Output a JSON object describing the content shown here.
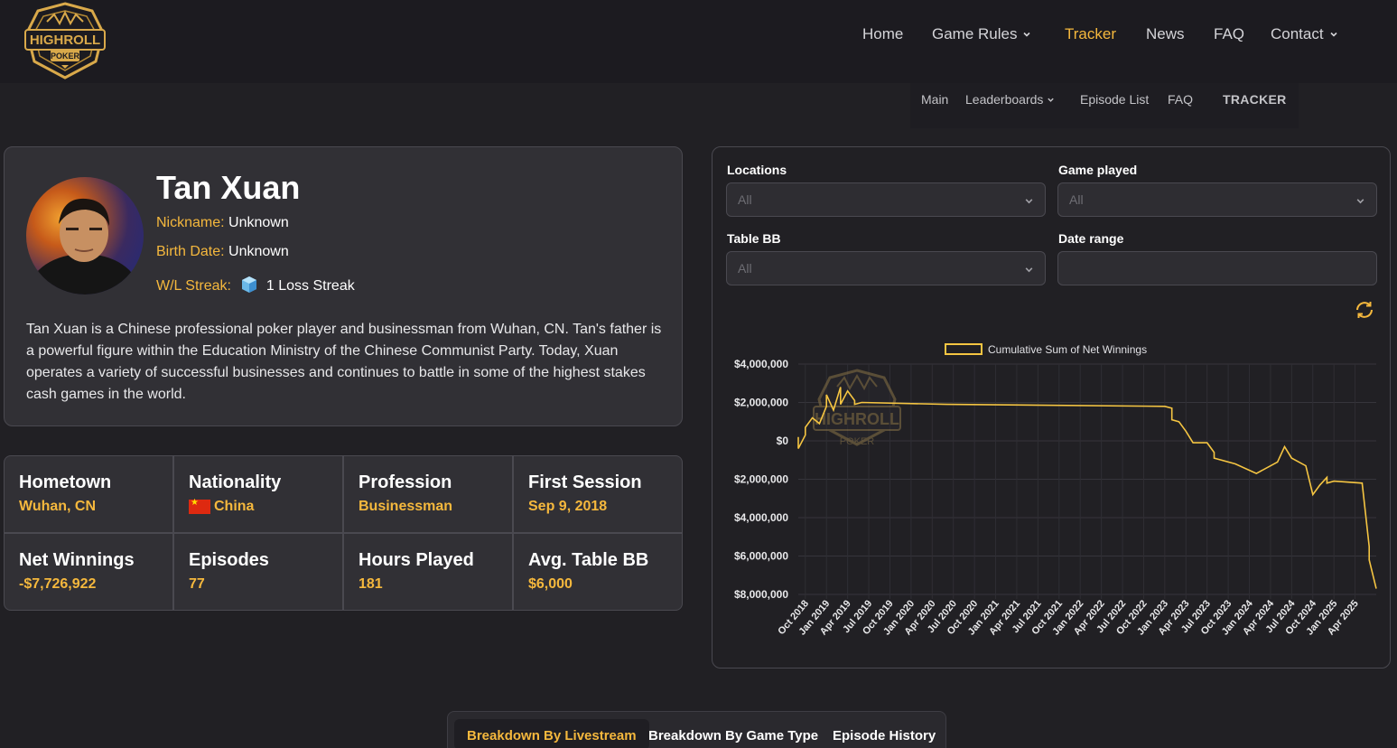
{
  "brand": {
    "logo_text": "HIGHROLL",
    "logo_sub": "POKER",
    "gold": "#f5b83d"
  },
  "nav": {
    "items": [
      {
        "label": "Home"
      },
      {
        "label": "Game Rules"
      },
      {
        "label": "Tracker"
      },
      {
        "label": "News"
      },
      {
        "label": "FAQ"
      },
      {
        "label": "Contact"
      }
    ],
    "active": "Tracker"
  },
  "subnav": {
    "items": [
      {
        "label": "Main"
      },
      {
        "label": "Leaderboards"
      },
      {
        "label": "Episode List"
      },
      {
        "label": "FAQ"
      },
      {
        "label": "TRACKER"
      }
    ]
  },
  "player": {
    "name": "Tan Xuan",
    "nickname_key": "Nickname:",
    "nickname": "Unknown",
    "birth_key": "Birth Date:",
    "birth": "Unknown",
    "streak_key": "W/L Streak:",
    "streak": "1 Loss Streak",
    "bio": "Tan Xuan is a Chinese professional poker player and businessman from Wuhan, CN. Tan's father is a powerful figure within the Education Ministry of the Chinese Communist Party. Today, Xuan operates a variety of successful businesses and continues to battle in some of the highest stakes cash games in the world."
  },
  "stats": [
    {
      "label": "Hometown",
      "value": "Wuhan, CN"
    },
    {
      "label": "Nationality",
      "value": "China",
      "flag": "china-flag"
    },
    {
      "label": "Profession",
      "value": "Businessman"
    },
    {
      "label": "First Session",
      "value": "Sep 9, 2018"
    },
    {
      "label": "Net Winnings",
      "value": "-$7,726,922"
    },
    {
      "label": "Episodes",
      "value": "77"
    },
    {
      "label": "Hours Played",
      "value": "181"
    },
    {
      "label": "Avg. Table BB",
      "value": "$6,000"
    }
  ],
  "filters": {
    "locations_label": "Locations",
    "locations_value": "All",
    "game_label": "Game played",
    "game_value": "All",
    "bb_label": "Table BB",
    "bb_value": "All",
    "date_label": "Date range",
    "date_value": ""
  },
  "chart_data": {
    "type": "line",
    "title": "",
    "legend": [
      "Cumulative Sum of Net Winnings"
    ],
    "legend_position": "top-center",
    "grid": true,
    "y_tick_labels": [
      "$4,000,000",
      "$2,000,000",
      "$0",
      "$2,000,000",
      "$4,000,000",
      "$6,000,000",
      "$8,000,000"
    ],
    "y_tick_values": [
      4000000,
      2000000,
      0,
      -2000000,
      -4000000,
      -6000000,
      -8000000
    ],
    "ylim": [
      -8000000,
      4000000
    ],
    "x_tick_labels": [
      "Oct 2018",
      "Jan 2019",
      "Apr 2019",
      "Jul 2019",
      "Oct 2019",
      "Jan 2020",
      "Apr 2020",
      "Jul 2020",
      "Oct 2020",
      "Jan 2021",
      "Apr 2021",
      "Jul 2021",
      "Oct 2021",
      "Jan 2022",
      "Apr 2022",
      "Jul 2022",
      "Oct 2022",
      "Jan 2023",
      "Apr 2023",
      "Jul 2023",
      "Oct 2023",
      "Jan 2024",
      "Apr 2024",
      "Jul 2024",
      "Oct 2024",
      "Jan 2025",
      "Apr 2025"
    ],
    "series": [
      {
        "name": "Cumulative Sum of Net Winnings",
        "color": "#f5c542",
        "points": [
          [
            "2018-09",
            200000
          ],
          [
            "2018-09",
            -400000
          ],
          [
            "2018-10",
            300000
          ],
          [
            "2018-10",
            700000
          ],
          [
            "2018-11",
            1200000
          ],
          [
            "2018-12",
            900000
          ],
          [
            "2019-01",
            1800000
          ],
          [
            "2019-01",
            2400000
          ],
          [
            "2019-02",
            1600000
          ],
          [
            "2019-03",
            2800000
          ],
          [
            "2019-03",
            1900000
          ],
          [
            "2019-04",
            2600000
          ],
          [
            "2019-05",
            2100000
          ],
          [
            "2019-05",
            1900000
          ],
          [
            "2019-06",
            2000000
          ],
          [
            "2020-06",
            1900000
          ],
          [
            "2023-01",
            1800000
          ],
          [
            "2023-02",
            1700000
          ],
          [
            "2023-02",
            1100000
          ],
          [
            "2023-03",
            1000000
          ],
          [
            "2023-04",
            500000
          ],
          [
            "2023-05",
            -100000
          ],
          [
            "2023-07",
            -100000
          ],
          [
            "2023-08",
            -600000
          ],
          [
            "2023-08",
            -900000
          ],
          [
            "2023-11",
            -1200000
          ],
          [
            "2024-02",
            -1700000
          ],
          [
            "2024-05",
            -1100000
          ],
          [
            "2024-06",
            -300000
          ],
          [
            "2024-07",
            -900000
          ],
          [
            "2024-09",
            -1300000
          ],
          [
            "2024-10",
            -2800000
          ],
          [
            "2024-11",
            -2300000
          ],
          [
            "2024-12",
            -1900000
          ],
          [
            "2024-12",
            -2200000
          ],
          [
            "2025-01",
            -2100000
          ],
          [
            "2025-05",
            -2200000
          ],
          [
            "2025-06",
            -5500000
          ],
          [
            "2025-06",
            -6200000
          ],
          [
            "2025-07",
            -7700000
          ]
        ]
      }
    ]
  },
  "tabs": [
    {
      "label": "Breakdown By Livestream"
    },
    {
      "label": "Breakdown By Game Type"
    },
    {
      "label": "Episode History"
    }
  ]
}
